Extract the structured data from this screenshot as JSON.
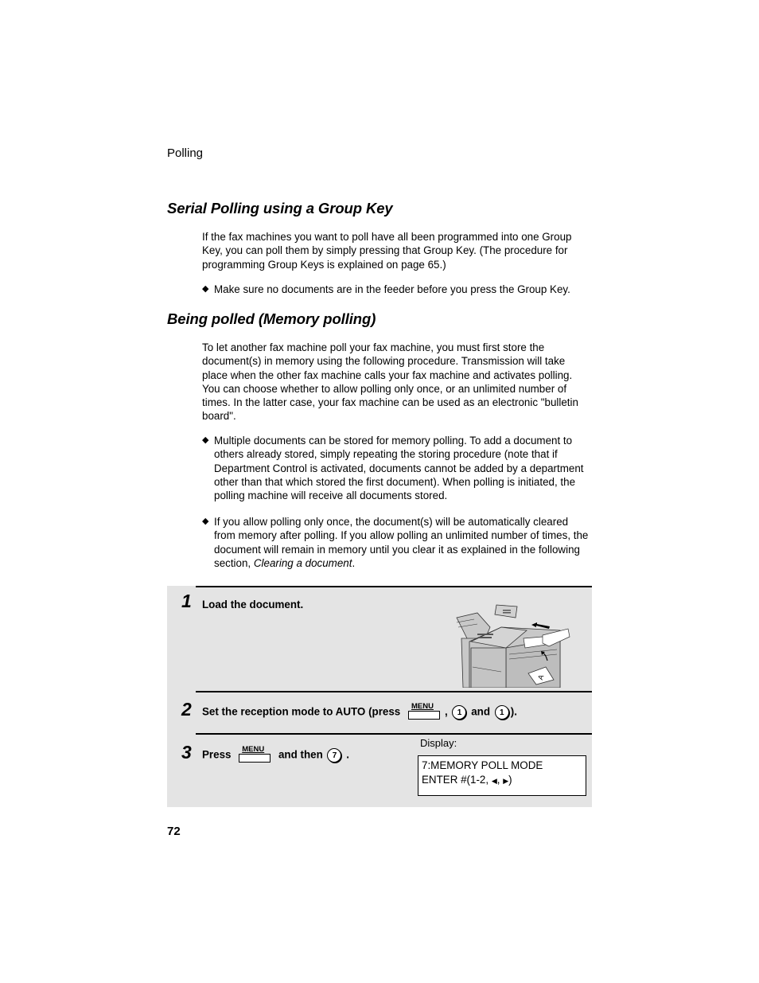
{
  "running_head": "Polling",
  "sections": [
    {
      "title": "Serial Polling using a Group Key",
      "paragraph": "If the fax machines you want to poll have all been programmed into one Group Key, you can poll them by simply pressing that Group Key. (The procedure for programming Group Keys is explained on page 65.)",
      "bullets": [
        {
          "text": "Make sure no documents are in the feeder before you press the Group Key."
        }
      ]
    },
    {
      "title": "Being polled (Memory polling)",
      "paragraph": "To let another fax machine poll your fax machine, you must first store the document(s) in memory using the following procedure. Transmission will take place when the other fax machine calls your fax machine and activates polling. You can choose whether to allow polling only once, or an unlimited number of times. In the latter case, your fax machine can be used as an electronic \"bulletin board\".",
      "bullets": [
        {
          "text": "Multiple documents can be stored for memory polling. To add a document to others already stored, simply repeating the storing procedure (note that if Department Control is activated, documents cannot be added by a department other than that which stored the first document). When polling is initiated, the polling machine will receive all documents stored."
        },
        {
          "text": "If you allow polling only once, the document(s) will be automatically cleared from memory after polling. If you allow polling an unlimited number of times, the document will remain in memory until you clear it as explained in the following section, ",
          "italic_tail": "Clearing a document",
          "tail_end": "."
        }
      ]
    }
  ],
  "steps": [
    {
      "number": "1",
      "text": "Load the document.",
      "illustration": "fax-machine-loading-document"
    },
    {
      "number": "2",
      "text_before": "Set the reception mode to AUTO (press",
      "key_menu": "MENU",
      "sep": ",",
      "key_a": "1",
      "and": "and",
      "key_b": "1",
      "text_after": ")."
    },
    {
      "number": "3",
      "text_before": "Press",
      "key_menu": "MENU",
      "and_then": "and then",
      "key_a": "7",
      "text_after": ".",
      "display_label": "Display:",
      "display_line1": "7:MEMORY POLL MODE",
      "display_line2_prefix": "ENTER #(1-2,",
      "display_left_arrow": "◀",
      "display_comma": ",",
      "display_right_arrow": "▶",
      "display_line2_suffix": ")"
    }
  ],
  "page_number": "72",
  "colors": {
    "step_box_bg": "#e4e4e4",
    "text": "#000000"
  }
}
